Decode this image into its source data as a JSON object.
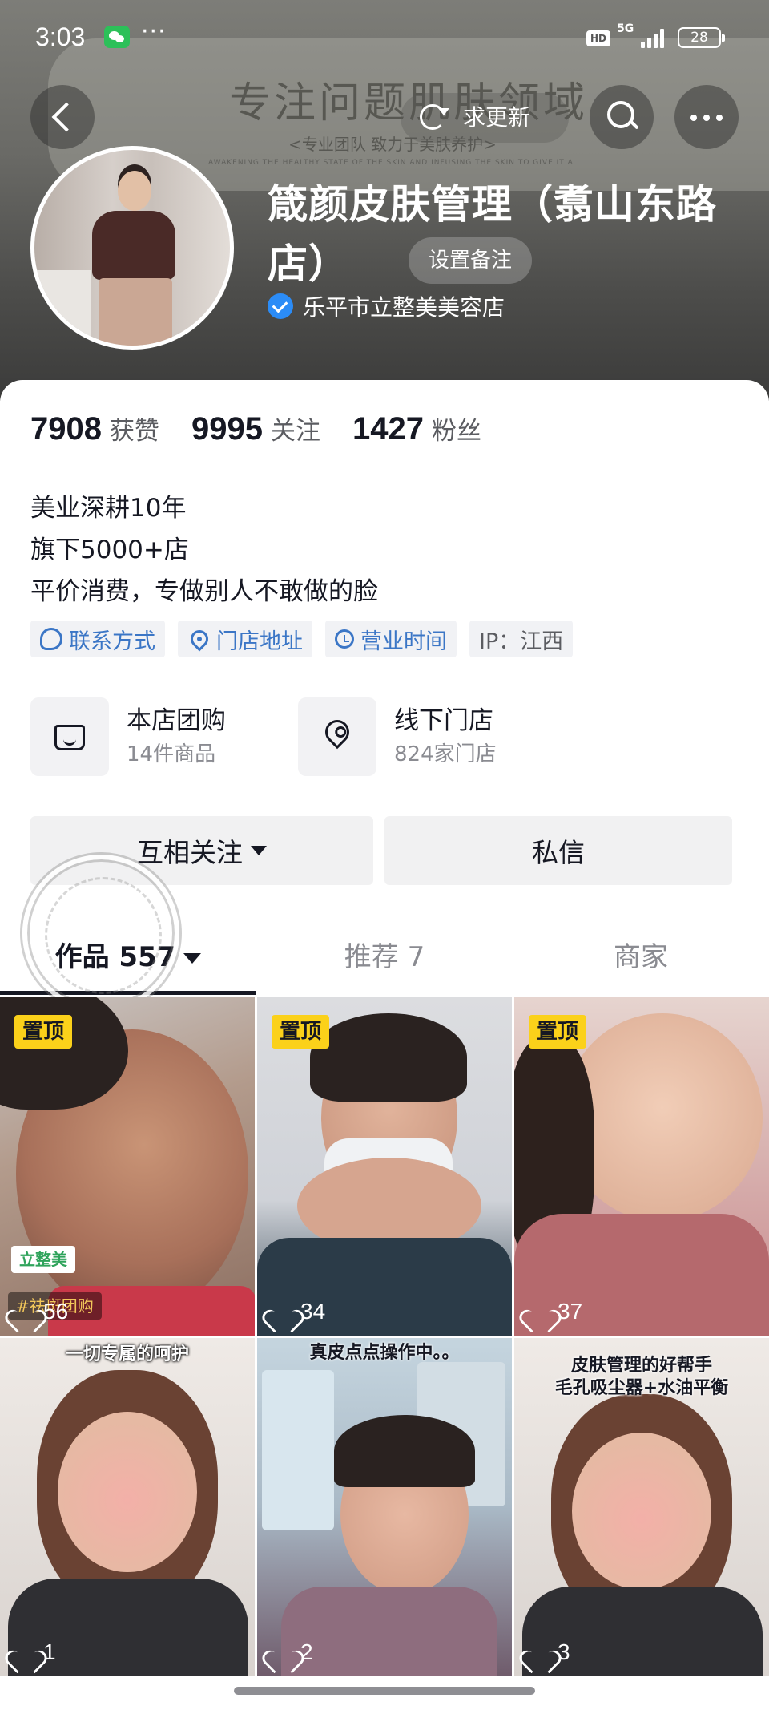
{
  "status_bar": {
    "time": "3:03",
    "dots": "···",
    "hd": "HD",
    "network": "5G",
    "battery": "28"
  },
  "banner": {
    "slogan": "专注问题肌肤领域",
    "subtitle": "<专业团队 致力于美肤养护>",
    "fine_print": "AWAKENING THE HEALTHY STATE OF THE SKIN AND INFUSING THE SKIN TO GIVE IT A NEW LIFE"
  },
  "nav": {
    "update_label": "求更新"
  },
  "profile": {
    "name": "箴颜皮肤管理（翥山东路店）",
    "remark_button": "设置备注",
    "verified_org": "乐平市立整美美容店"
  },
  "stats": [
    {
      "num": "7908",
      "label": "获赞"
    },
    {
      "num": "9995",
      "label": "关注"
    },
    {
      "num": "1427",
      "label": "粉丝"
    }
  ],
  "bio": [
    "美业深耕10年",
    "旗下5000+店",
    "平价消费，专做别人不敢做的脸"
  ],
  "tags": {
    "contact": "联系方式",
    "address": "门店地址",
    "hours": "营业时间",
    "ip": "IP：江西"
  },
  "services": {
    "group_buy": {
      "title": "本店团购",
      "sub": "14件商品"
    },
    "offline": {
      "title": "线下门店",
      "sub": "824家门店"
    }
  },
  "actions": {
    "follow": "互相关注",
    "message": "私信"
  },
  "tabs": {
    "works": "作品 557",
    "recommend": "推荐 7",
    "merchant": "商家"
  },
  "videos": [
    {
      "pinned": "置顶",
      "likes": "56",
      "loc_badge": "立整美",
      "tag_badge": "#祛斑团购",
      "caption": ""
    },
    {
      "pinned": "置顶",
      "likes": "34",
      "caption": ""
    },
    {
      "pinned": "置顶",
      "likes": "37",
      "caption": ""
    },
    {
      "pinned": "",
      "likes": "1",
      "caption": "一切专属的呵护"
    },
    {
      "pinned": "",
      "likes": "2",
      "caption": "真皮点点操作中。。"
    },
    {
      "pinned": "",
      "likes": "3",
      "caption": "皮肤管理的好帮手",
      "caption2": "毛孔吸尘器+水油平衡"
    }
  ],
  "colors": {
    "accent_blue": "#3b76c6",
    "pin_yellow": "#fbd11a",
    "verify_blue": "#2b8cf7"
  }
}
